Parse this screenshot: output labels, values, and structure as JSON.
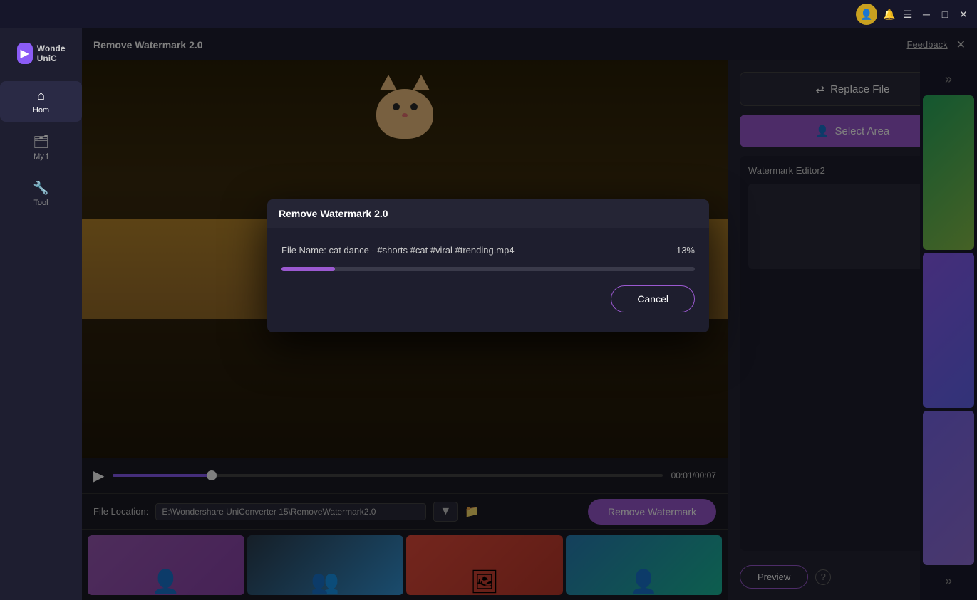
{
  "titlebar": {
    "minimize_label": "─",
    "maximize_label": "□",
    "close_label": "✕"
  },
  "header": {
    "feedback_label": "Feedback",
    "title": "Remove Watermark 2.0",
    "close_label": "✕"
  },
  "sidebar": {
    "logo_line1": "Wonde",
    "logo_line2": "UniC",
    "items": [
      {
        "id": "home",
        "label": "Hom",
        "icon": "⌂"
      },
      {
        "id": "myfiles",
        "label": "My f",
        "icon": "🗂"
      },
      {
        "id": "tools",
        "label": "Tool",
        "icon": "🔧"
      }
    ]
  },
  "video": {
    "time_current": "00:01",
    "time_total": "00:07",
    "time_display": "00:01/00:07",
    "progress_percent": 18
  },
  "file_location": {
    "label": "File Location:",
    "path": "E:\\Wondershare UniConverter 15\\RemoveWatermark2.0",
    "remove_btn_label": "Remove Watermark"
  },
  "right_panel": {
    "replace_file_btn": "Replace File",
    "select_area_btn": "Select Area",
    "watermark_editor_title": "Watermark Editor2",
    "preview_btn": "Preview",
    "help_icon": "?"
  },
  "modal": {
    "title": "Remove Watermark 2.0",
    "file_label": "File Name: cat dance - #shorts #cat #viral #trending.mp4",
    "progress_percent_label": "13%",
    "progress_value": 13,
    "cancel_btn": "Cancel"
  }
}
